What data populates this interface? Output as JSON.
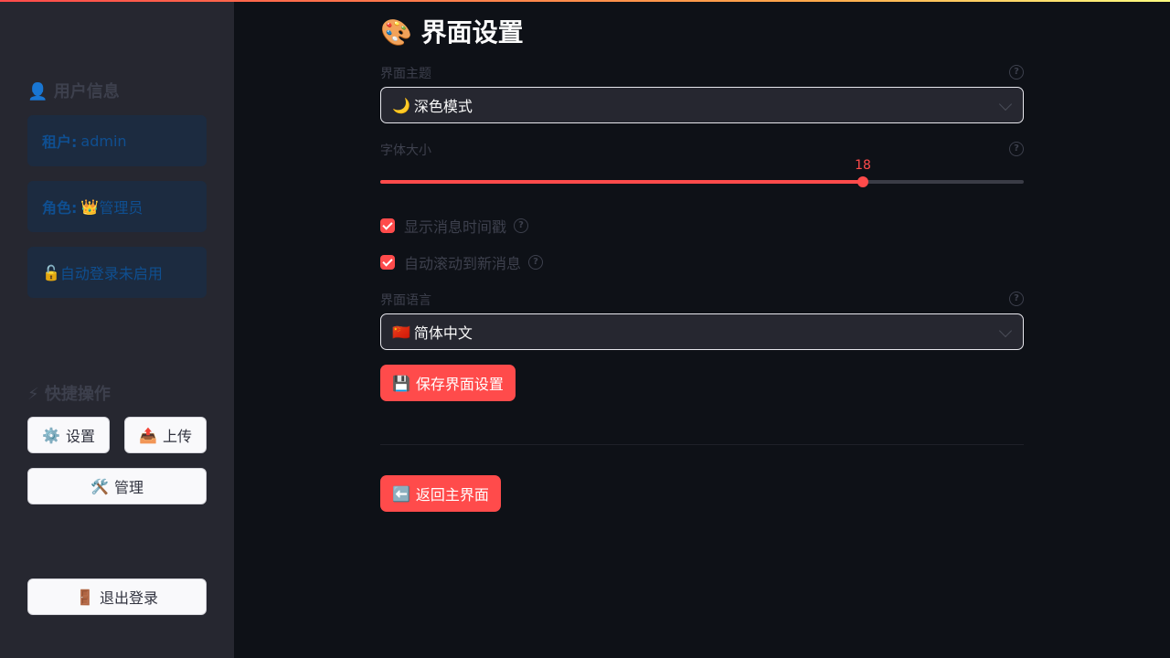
{
  "sidebar": {
    "user_section": {
      "icon": "👤",
      "title": "用户信息"
    },
    "user_info": [
      {
        "key": "租户:",
        "value": "admin"
      },
      {
        "key": "角色:",
        "icon": "👑",
        "value": "管理员"
      },
      {
        "icon": "🔓",
        "value": "自动登录未启用"
      }
    ],
    "actions_section": {
      "icon": "⚡",
      "title": "快捷操作"
    },
    "actions": {
      "settings": {
        "icon": "⚙️",
        "label": "设置"
      },
      "upload": {
        "icon": "📤",
        "label": "上传"
      },
      "manage": {
        "icon": "🛠️",
        "label": "管理"
      }
    },
    "logout": {
      "icon": "🚪",
      "label": "退出登录"
    }
  },
  "main": {
    "title": {
      "icon": "🎨",
      "text": "界面设置"
    },
    "theme": {
      "label": "界面主题",
      "icon": "🌙",
      "value": "深色模式"
    },
    "font_size": {
      "label": "字体大小",
      "value": 18,
      "fraction": 0.75
    },
    "checkboxes": [
      {
        "label": "显示消息时间戳",
        "checked": true
      },
      {
        "label": "自动滚动到新消息",
        "checked": true
      }
    ],
    "language": {
      "label": "界面语言",
      "icon": "🇨🇳",
      "value": "简体中文"
    },
    "save_button": {
      "icon": "💾",
      "label": "保存界面设置"
    },
    "back_button": {
      "icon": "⬅️",
      "label": "返回主界面"
    }
  },
  "colors": {
    "accent": "#ff4b4b",
    "background": "#0e1117",
    "sidebar": "#262730"
  }
}
